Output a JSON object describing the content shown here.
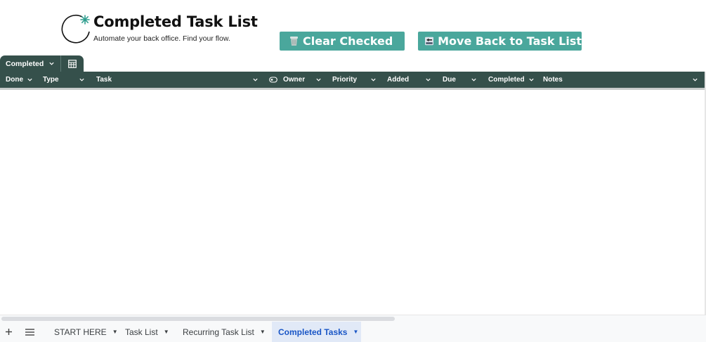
{
  "header": {
    "title": "Completed Task List",
    "tagline": "Automate your back office. Find your flow."
  },
  "actions": {
    "clear_checked": "Clear Checked",
    "move_back": "Move Back to Task List"
  },
  "table_tab": {
    "label": "Completed"
  },
  "columns": [
    {
      "label": "Done"
    },
    {
      "label": "Type"
    },
    {
      "label": "Task"
    },
    {
      "label": "Owner"
    },
    {
      "label": "Priority"
    },
    {
      "label": "Added"
    },
    {
      "label": "Due"
    },
    {
      "label": "Completed"
    },
    {
      "label": "Notes"
    }
  ],
  "sheet_tabs": [
    {
      "label": "START HERE"
    },
    {
      "label": "Task List"
    },
    {
      "label": "Recurring Task List"
    },
    {
      "label": "Completed Tasks",
      "active": true
    }
  ],
  "colors": {
    "header_bg": "#35504b",
    "button_bg": "#4aa79c",
    "active_tab_text": "#1a56c6"
  }
}
